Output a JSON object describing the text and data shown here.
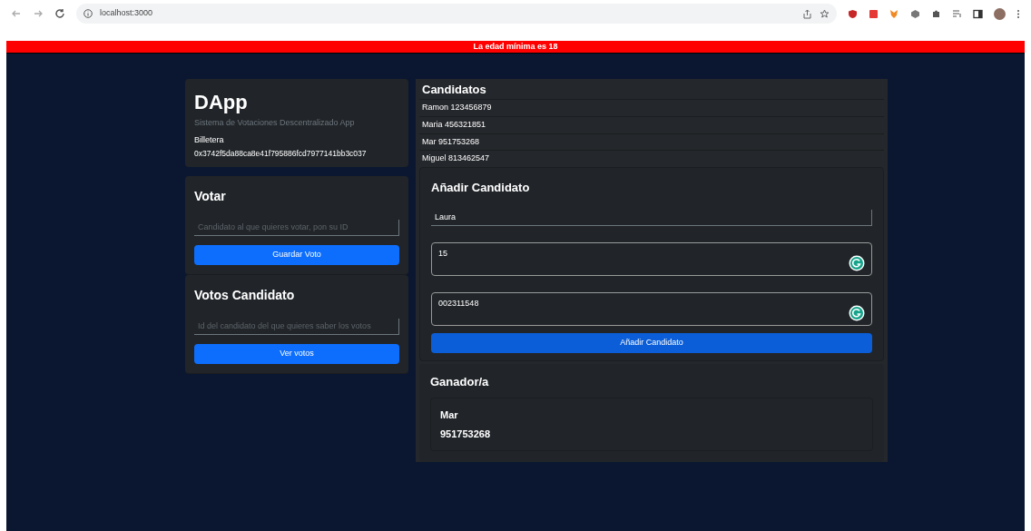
{
  "browser": {
    "url": "localhost:3000"
  },
  "alert": "La edad mínima es 18",
  "header": {
    "title": "DApp",
    "subtitle": "Sistema de Votaciones Descentralizado App",
    "wallet_label": "Billetera",
    "wallet_address": "0x3742f5da88ca8e41f795886fcd7977141bb3c037"
  },
  "vote": {
    "title": "Votar",
    "placeholder": "Candidato al que quieres votar, pon su ID",
    "button": "Guardar Voto"
  },
  "votes": {
    "title": "Votos Candidato",
    "placeholder": "Id del candidato del que quieres saber los votos",
    "button": "Ver votos"
  },
  "candidates": {
    "title": "Candidatos",
    "items": [
      "Ramon 123456879",
      "Maria 456321851",
      "Mar 951753268",
      "Miguel 813462547"
    ]
  },
  "add_candidate": {
    "title": "Añadir Candidato",
    "fields": [
      {
        "kind": "input",
        "value": "Laura"
      },
      {
        "kind": "textarea",
        "value": "15"
      },
      {
        "kind": "textarea",
        "value": "002311548"
      }
    ],
    "button": "Añadir Candidato"
  },
  "winner": {
    "title": "Ganador/a",
    "name": "Mar",
    "id": "951753268"
  }
}
